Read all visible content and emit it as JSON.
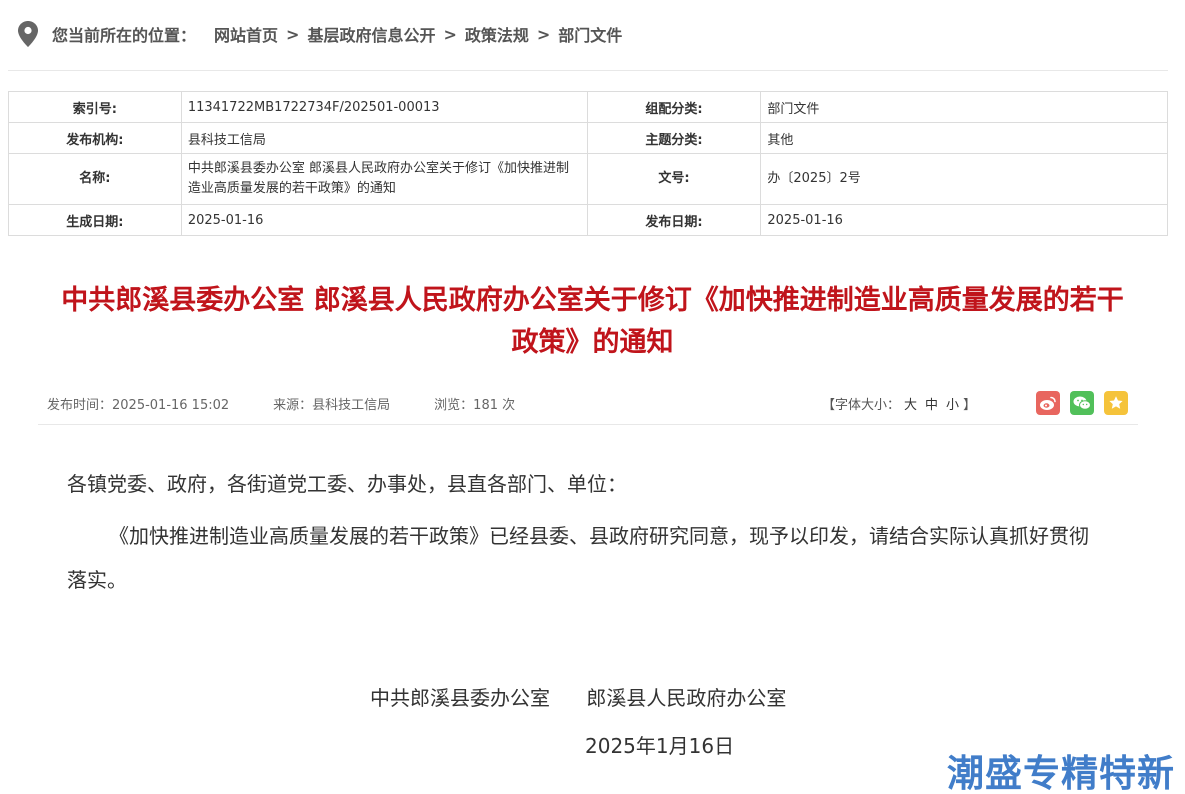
{
  "breadcrumb": {
    "lead": "您当前所在的位置：",
    "items": [
      "网站首页",
      "基层政府信息公开",
      "政策法规",
      "部门文件"
    ],
    "sep": ">"
  },
  "meta": {
    "index_label": "索引号:",
    "index_value": "11341722MB1722734F/202501-00013",
    "group_label": "组配分类:",
    "group_value": "部门文件",
    "org_label": "发布机构:",
    "org_value": "县科技工信局",
    "topic_label": "主题分类:",
    "topic_value": "其他",
    "name_label": "名称:",
    "name_value": "中共郎溪县委办公室 郎溪县人民政府办公室关于修订《加快推进制造业高质量发展的若干政策》的通知",
    "docno_label": "文号:",
    "docno_value": "办〔2025〕2号",
    "created_label": "生成日期:",
    "created_value": "2025-01-16",
    "published_label": "发布日期:",
    "published_value": "2025-01-16"
  },
  "article": {
    "title": "中共郎溪县委办公室 郎溪县人民政府办公室关于修订《加快推进制造业高质量发展的若干政策》的通知",
    "publish_time": "发布时间：2025-01-16 15:02",
    "source": "来源：县科技工信局",
    "views": "浏览：181 次",
    "fontsize_open": "【字体大小：",
    "fontsize_large": "大",
    "fontsize_mid": "中",
    "fontsize_small": "小",
    "fontsize_close": "】",
    "salutation": "各镇党委、政府，各街道党工委、办事处，县直各部门、单位：",
    "paragraph": "《加快推进制造业高质量发展的若干政策》已经县委、县政府研究同意，现予以印发，请结合实际认真抓好贯彻落实。",
    "sign_org1": "中共郎溪县委办公室",
    "sign_org2": "郎溪县人民政府办公室",
    "sign_date": "2025年1月16日"
  },
  "share": {
    "weibo_icon": "weibo-icon",
    "weibo_color": "#e8665f",
    "wechat_icon": "wechat-icon",
    "wechat_color": "#51c05a",
    "favorite_icon": "star-icon",
    "favorite_color": "#f5c33b"
  },
  "watermark": "潮盛专精特新"
}
